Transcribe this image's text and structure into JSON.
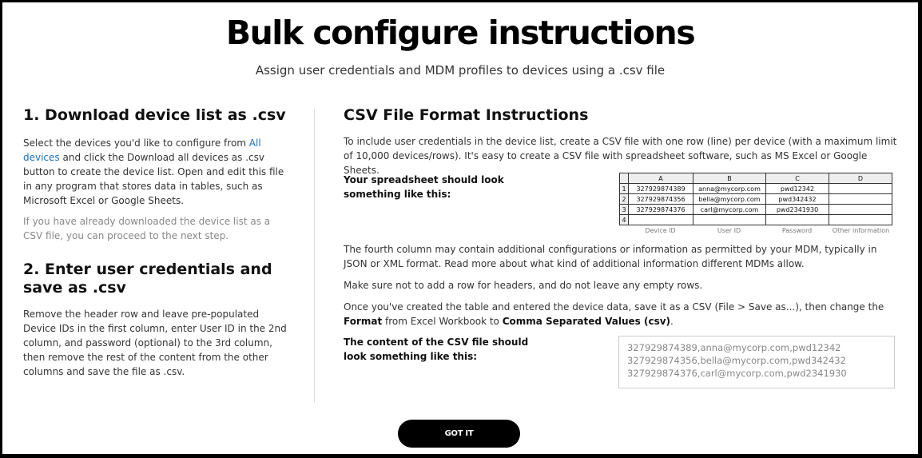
{
  "header": {
    "title": "Bulk configure instructions",
    "subtitle": "Assign user credentials and MDM profiles to devices using a .csv file"
  },
  "step1": {
    "heading": "1. Download device list as .csv",
    "text_before_link": "Select the devices you'd like to configure from ",
    "link": "All devices",
    "text_after_link": " and click the Download all devices as .csv button to create the device list. Open and edit this file in any program that stores data in tables, such as Microsoft Excel or Google Sheets.",
    "note": "If you have already downloaded the device list as a CSV file, you can proceed to the next step."
  },
  "step2": {
    "heading": "2. Enter user credentials and save as .csv",
    "text": "Remove the header row and leave pre-populated Device IDs in the first column, enter User ID in the 2nd column, and password (optional) to the 3rd column, then remove the rest of the content from the other columns and save the file as .csv."
  },
  "csv_format": {
    "heading": "CSV File Format Instructions",
    "intro": "To include user credentials in the device list, create a CSV file with one row (line) per device (with a maximum limit of 10,000 devices/rows). It's easy to create a CSV file with spreadsheet software, such as MS Excel or Google Sheets.",
    "spreadsheet_label": "Your spreadsheet should look something like this:",
    "sheet": {
      "columns": [
        "A",
        "B",
        "C",
        "D"
      ],
      "rows": [
        {
          "n": "1",
          "a": "327929874389",
          "b": "anna@mycorp.com",
          "c": "pwd12342",
          "d": ""
        },
        {
          "n": "2",
          "a": "327929874356",
          "b": "bella@mycorp.com",
          "c": "pwd342432",
          "d": ""
        },
        {
          "n": "3",
          "a": "327929874376",
          "b": "carl@mycorp.com",
          "c": "pwd2341930",
          "d": ""
        },
        {
          "n": "4",
          "a": "",
          "b": "",
          "c": "",
          "d": ""
        }
      ],
      "captions": [
        "Device ID",
        "User ID",
        "Password",
        "Other information"
      ]
    },
    "fourth_column": "The fourth column may contain additional configurations or information as permitted by your MDM, typically in JSON or XML format. Read more about what kind of additional information different MDMs allow.",
    "no_headers": "Make sure not to add a row for headers, and do not leave any empty rows.",
    "save_before_format": "Once you've created the table and entered the device data, save it as a CSV (File > Save as...), then change the ",
    "save_format_word": "Format",
    "save_middle": " from Excel Workbook to ",
    "save_csv_name": "Comma Separated Values (csv)",
    "save_end": ".",
    "csv_content_label": "The content of the CSV file should look something like this:",
    "csv_lines": [
      "327929874389,anna@mycorp.com,pwd12342",
      "327929874356,bella@mycorp.com,pwd342432",
      "327929874376,carl@mycorp.com,pwd2341930"
    ]
  },
  "actions": {
    "got_it": "GOT IT"
  }
}
